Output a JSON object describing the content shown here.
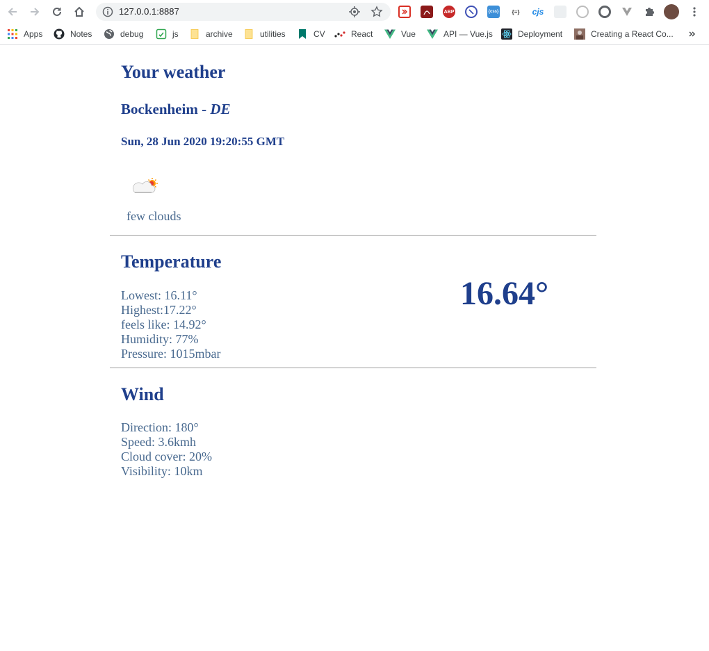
{
  "browser": {
    "url": "127.0.0.1:8887",
    "bookmarks": [
      {
        "label": "Apps",
        "icon": "apps-grid-icon"
      },
      {
        "label": "Notes",
        "icon": "github-icon"
      },
      {
        "label": "debug",
        "icon": "globe-icon"
      },
      {
        "label": "js",
        "icon": "shield-icon"
      },
      {
        "label": "archive",
        "icon": "folder-icon"
      },
      {
        "label": "utilities",
        "icon": "folder-icon"
      },
      {
        "label": "CV",
        "icon": "bookmark-icon"
      },
      {
        "label": "React",
        "icon": "react-dots-icon"
      },
      {
        "label": "Vue",
        "icon": "vue-icon"
      },
      {
        "label": "API — Vue.js",
        "icon": "vue-icon"
      },
      {
        "label": "Deployment",
        "icon": "react-atom-icon"
      },
      {
        "label": "Creating a React Co...",
        "icon": "avatar-icon"
      }
    ],
    "extensions": {
      "abp": "ABP",
      "css": "{css}",
      "json": "{≡}",
      "cjs": "cjs"
    }
  },
  "weather": {
    "heading": "Your weather",
    "city": "Bockenheim",
    "separator": " - ",
    "country": "DE",
    "datetime": "Sun, 28 Jun 2020 19:20:55 GMT",
    "icon": "few-clouds-day-icon",
    "description": "few clouds"
  },
  "temperature": {
    "heading": "Temperature",
    "current": "16.64°",
    "stats": [
      {
        "label": "Lowest: ",
        "value": "16.11°"
      },
      {
        "label": "Highest:",
        "value": "17.22°"
      },
      {
        "label": "feels like: ",
        "value": "14.92°"
      },
      {
        "label": "Humidity: ",
        "value": "77%"
      },
      {
        "label": "Pressure: ",
        "value": "1015mbar"
      }
    ]
  },
  "wind": {
    "heading": "Wind",
    "stats": [
      {
        "label": "Direction: ",
        "value": "180°"
      },
      {
        "label": "Speed: ",
        "value": "3.6kmh"
      },
      {
        "label": "Cloud cover: ",
        "value": "20%"
      },
      {
        "label": "Visibility: ",
        "value": "10km"
      }
    ]
  },
  "colors": {
    "heading": "#1f3f8c",
    "body_text": "#48698f",
    "divider": "#9e9e9e"
  }
}
